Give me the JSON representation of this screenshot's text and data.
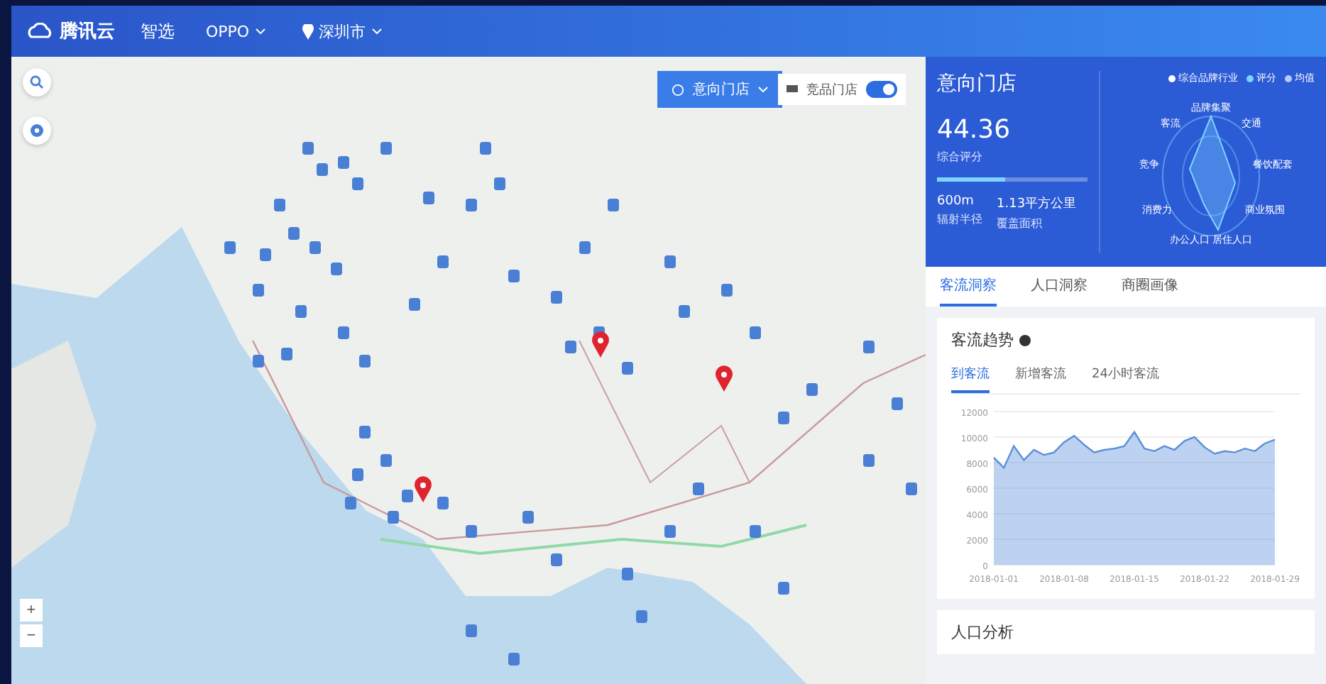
{
  "header": {
    "logo": "腾讯云",
    "product": "智选",
    "brand": {
      "label": "OPPO"
    },
    "city": {
      "label": "深圳市"
    }
  },
  "map": {
    "store_filter": {
      "label": "意向门店"
    },
    "competitor_toggle": {
      "label": "竞品门店",
      "on": true
    },
    "zoom_in": "+",
    "zoom_out": "−"
  },
  "summary": {
    "title": "意向门店",
    "score": "44.36",
    "score_label": "综合评分",
    "level": 0.45,
    "radius": "600m",
    "radius_label": "辐射半径",
    "area": "1.13平方公里",
    "area_label": "覆盖面积",
    "legend": [
      {
        "label": "综合品牌行业",
        "color": "#ffffff"
      },
      {
        "label": "评分",
        "color": "#7fd3ff"
      },
      {
        "label": "均值",
        "color": "#b8c9ff"
      }
    ],
    "radar_axes": [
      "品牌集聚",
      "交通",
      "餐饮配套",
      "商业氛围",
      "居住人口",
      "办公人口",
      "消费力",
      "竞争",
      "客流"
    ]
  },
  "tabs": [
    {
      "label": "客流洞察",
      "selected": true
    },
    {
      "label": "人口洞察",
      "selected": false
    },
    {
      "label": "商圈画像",
      "selected": false
    }
  ],
  "flow_card": {
    "title": "客流趋势",
    "subtabs": [
      {
        "label": "到客流",
        "selected": true
      },
      {
        "label": "新增客流",
        "selected": false
      },
      {
        "label": "24小时客流",
        "selected": false
      }
    ],
    "chart_data": {
      "type": "area",
      "categories": [
        "2018-01-01",
        null,
        null,
        null,
        null,
        null,
        null,
        "2018-01-08",
        null,
        null,
        null,
        null,
        null,
        null,
        "2018-01-15",
        null,
        null,
        null,
        null,
        null,
        null,
        "2018-01-22",
        null,
        null,
        null,
        null,
        null,
        null,
        "2018-01-29"
      ],
      "grid": true,
      "ylim": [
        0,
        12000
      ],
      "yticks": [
        0,
        2000,
        4000,
        6000,
        8000,
        10000,
        12000
      ],
      "series": [
        {
          "color": "#5b8fd9",
          "values": [
            8400,
            7600,
            9300,
            8200,
            9000,
            8600,
            8800,
            9600,
            10100,
            9400,
            8800,
            9000,
            9100,
            9300,
            10400,
            9100,
            8900,
            9300,
            9000,
            9700,
            10000,
            9200,
            8700,
            8900,
            8800,
            9100,
            8900,
            9500,
            9800
          ]
        }
      ]
    }
  },
  "population_card": {
    "title": "人口分析"
  }
}
